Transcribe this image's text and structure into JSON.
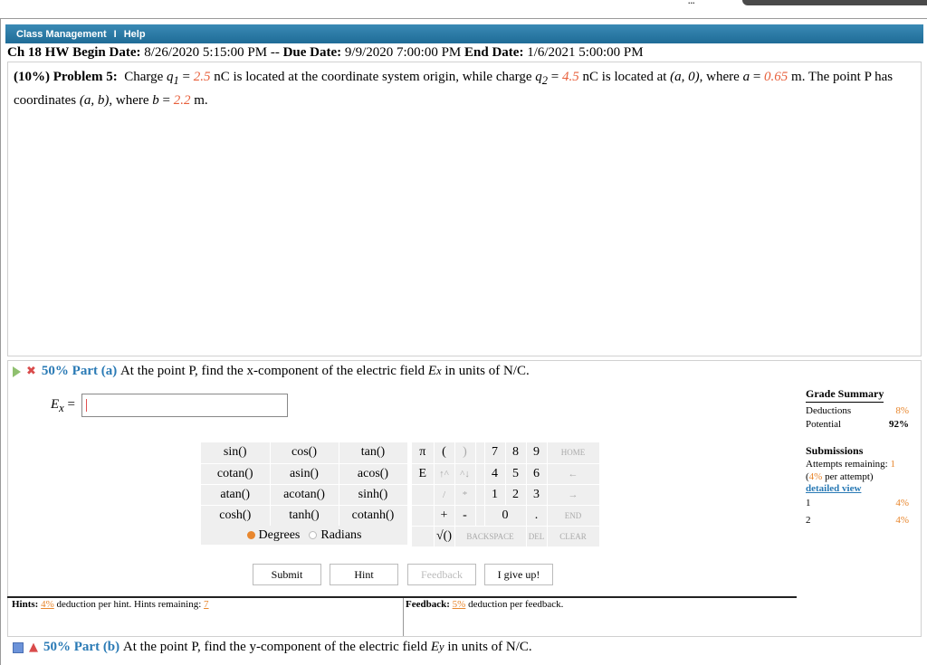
{
  "top_fragment": "...",
  "menu": {
    "items": [
      "Class Management",
      "I",
      "Help"
    ]
  },
  "hw": {
    "title": "Ch 18 HW",
    "begin_label": "Begin Date:",
    "begin_date": "8/26/2020 5:15:00 PM --",
    "due_label": "Due Date:",
    "due_date": "9/9/2020 7:00:00 PM",
    "end_label": "End Date:",
    "end_date": "1/6/2021 5:00:00 PM"
  },
  "problem": {
    "weight": "(10%)",
    "number": "Problem 5:",
    "t1": "Charge",
    "q1": "q",
    "q1_sub": "1",
    "eq": " = ",
    "q1_val": "2.5",
    "t2": " nC is located at the coordinate system origin, while charge ",
    "q2": "q",
    "q2_sub": "2",
    "q2_val": "4.5",
    "t3": " nC is located at ",
    "coord": "(a, 0)",
    "t4": ", where ",
    "a_var": "a",
    "a_val": "0.65",
    "t5": " m. The point P has coordinates ",
    "p_coord": "(a, b)",
    "t6": ", where ",
    "b_var": "b",
    "b_val": "2.2",
    "t7": " m."
  },
  "partA": {
    "percent": "50% Part (a)",
    "text": "At the point P, find the x-component of the electric field",
    "var": "E",
    "var_sub": "x",
    "text2": "in units of N/C.",
    "input_label": "E",
    "input_sub": "x",
    "input_eq": " =",
    "input_value": ""
  },
  "calc": {
    "functions": [
      [
        "sin()",
        "cos()",
        "tan()"
      ],
      [
        "cotan()",
        "asin()",
        "acos()"
      ],
      [
        "atan()",
        "acotan()",
        "sinh()"
      ],
      [
        "cosh()",
        "tanh()",
        "cotanh()"
      ]
    ],
    "degrees": "Degrees",
    "radians": "Radians",
    "keys": {
      "pi": "π",
      "lparen": "(",
      "rparen": ")",
      "k7": "7",
      "k8": "8",
      "k9": "9",
      "home": "HOME",
      "e": "E",
      "up": "↑^",
      "down": "^↓",
      "k4": "4",
      "k5": "5",
      "k6": "6",
      "left": "←",
      "slash": "/",
      "star": "*",
      "k1": "1",
      "k2": "2",
      "k3": "3",
      "right": "→",
      "plus": "+",
      "minus": "-",
      "k0": "0",
      "dot": ".",
      "end": "END",
      "sqrt": "√()",
      "backspace": "BACKSPACE",
      "del": "DEL",
      "clear": "CLEAR"
    }
  },
  "buttons": {
    "submit": "Submit",
    "hint": "Hint",
    "feedback": "Feedback",
    "give_up": "I give up!"
  },
  "grade": {
    "title": "Grade Summary",
    "deductions_label": "Deductions",
    "deductions": "8%",
    "potential_label": "Potential",
    "potential": "92%",
    "submissions_title": "Submissions",
    "attempts_label": "Attempts remaining:",
    "attempts": "1",
    "per_attempt_pre": "(",
    "per_attempt_val": "4%",
    "per_attempt_post": " per attempt)",
    "detailed": "detailed view",
    "rows": [
      {
        "n": "1",
        "v": "4%"
      },
      {
        "n": "2",
        "v": "4%"
      }
    ]
  },
  "hints": {
    "label": "Hints:",
    "pct": "4%",
    "text": " deduction per hint. Hints remaining: ",
    "remaining": "7"
  },
  "feedback": {
    "label": "Feedback:",
    "pct": "5%",
    "text": " deduction per feedback."
  },
  "partB": {
    "percent": "50% Part (b)",
    "text": "At the point P, find the y-component of the electric field",
    "var": "E",
    "var_sub": "y",
    "text2": "in units of N/C."
  }
}
